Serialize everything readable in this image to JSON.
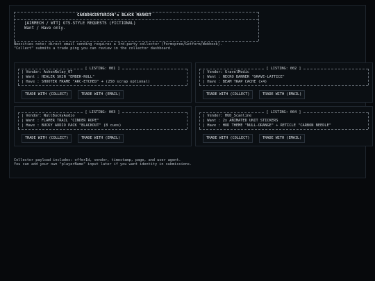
{
  "header": {
    "title": "CARBONCENTURION's BLACK MARKET",
    "tag": "[AIRMECH / WTT]  GTS-STYLE REQUESTS  (FICTIONAL)",
    "subtitle": "Want / Have only."
  },
  "notes": [
    "Neocities note: direct email sending requires a 3rd-party collector (Formspree/Getform/Webhook).",
    "\"Collect\" submits a trade ping you can review in the collector dashboard."
  ],
  "listings": [
    {
      "label": "[ LISTING: 001 ]",
      "vendor": "| Vendor: AshenRelay_07",
      "want": "| Want : HEALER SKIN \"EMBER-NULL\"",
      "have": "| Have : SHOOTER FRAME \"ARC-ETCHED\" + (250 scrap optional)",
      "collect_label": "TRADE WITH (COLLECT)",
      "email_label": "TRADE WITH (EMAIL)"
    },
    {
      "label": "[ LISTING: 002 ]",
      "vendor": "| Vendor: GravelMedic",
      "want": "| Want : NECRO BANNER \"GRAVE-LATTICE\"",
      "have": "| Have : BEAM TRAP CACHE (x4)",
      "collect_label": "TRADE WITH (COLLECT)",
      "email_label": "TRADE WITH (EMAIL)"
    },
    {
      "label": "[ LISTING: 003 ]",
      "vendor": "| Vendor: NullBuckyAudio",
      "want": "| Want : FLAMER TRAIL \"CINDER ROPE\"",
      "have": "| Have : BUCKY AUDIO PACK \"BLACKOUT\" (8 cues)",
      "collect_label": "TRADE WITH (COLLECT)",
      "email_label": "TRADE WITH (EMAIL)"
    },
    {
      "label": "[ LISTING: 004 ]",
      "vendor": "| Vendor: HUD_Scanline",
      "want": "| Want : 2x ANIMATED UNIT STICKERS",
      "have": "| Have : HUD THEME \"NULL-ORANGE\" + RETICLE \"CARBON NEEDLE\"",
      "collect_label": "TRADE WITH (COLLECT)",
      "email_label": "TRADE WITH (EMAIL)"
    }
  ],
  "footer": [
    "Collector payload includes: offerId, vendor, timestamp, page, and user agent.",
    "You can add your own \"playerName\" input later if you want identity in submissions."
  ]
}
